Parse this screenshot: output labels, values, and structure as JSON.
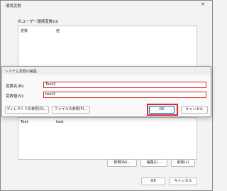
{
  "env_window": {
    "title": "環境変数",
    "close_glyph": "✕",
    "user_group_label": "のユーザー環境変数(U)",
    "columns": [
      "変数",
      "値"
    ],
    "system_rows": [
      {
        "variable": "Test",
        "value": "test"
      }
    ],
    "system_buttons": {
      "new": "新規(W)...",
      "edit": "編集(I)...",
      "delete": "削除(L)"
    },
    "footer_buttons": {
      "ok": "OK",
      "cancel": "キャンセル"
    }
  },
  "edit_dialog": {
    "title": "システム変数の編集",
    "name_label": "変数名(N):",
    "name_value": "Test2",
    "value_label": "変数値(V):",
    "value_value": "test2",
    "browse_dir": "ディレクトリの参照(D)...",
    "browse_file": "ファイルの参照(F)...",
    "ok": "OK",
    "cancel": "キャンセル"
  },
  "highlight_color": "#d32f2f"
}
